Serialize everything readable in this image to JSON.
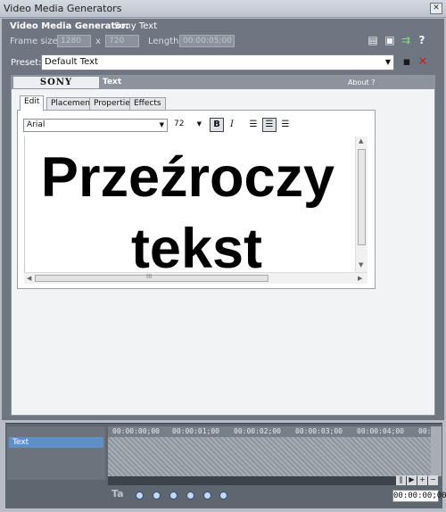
{
  "window": {
    "title": "Video Media Generators",
    "close": "✕"
  },
  "header": {
    "generator_label": "Video Media Generator:",
    "generator_name": "Sony Text",
    "frame_size_label": "Frame size:",
    "frame_width": "1280",
    "frame_x": "x",
    "frame_height": "720",
    "length_label": "Length:",
    "length_value": "00:00:05;00",
    "help": "?"
  },
  "preset": {
    "label": "Preset:",
    "value": "Default Text"
  },
  "plugin": {
    "brand": "SONY",
    "title": "Text",
    "about": "About  ?",
    "tabs": [
      "Edit",
      "Placement",
      "Properties",
      "Effects"
    ],
    "font": "Arial",
    "size": "72",
    "bold": "B",
    "italic": "I",
    "text_line1": "Przeźroczy",
    "text_line2": "tekst",
    "scroll_grip": "III"
  },
  "timeline": {
    "track_name": "Text",
    "ticks": [
      "00:00:00;00",
      "00:00:01;00",
      "00:00:02;00",
      "00:00:03;00",
      "00:00:04;00",
      "00:0"
    ],
    "timecode": "00:00:00;00"
  }
}
